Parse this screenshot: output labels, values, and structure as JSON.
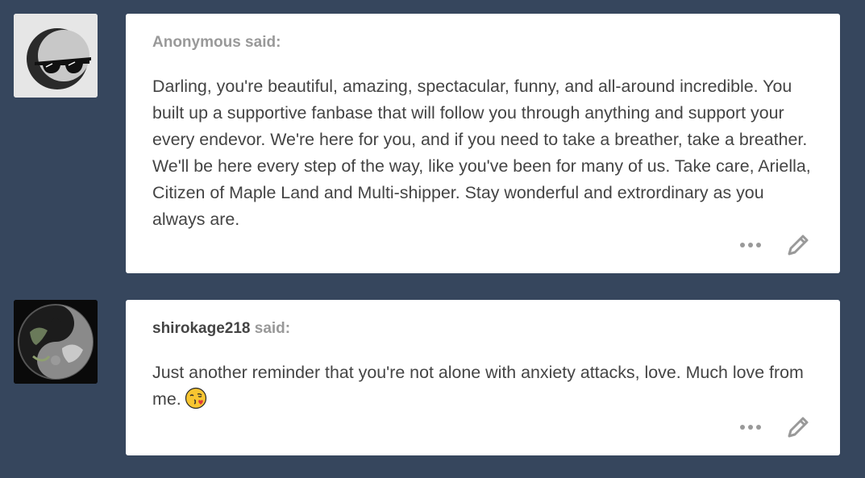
{
  "posts": [
    {
      "asker_name": "Anonymous",
      "asker_suffix": " said:",
      "body": "Darling, you're beautiful, amazing, spectacular, funny, and all-around incredible. You built up a supportive fanbase that will follow you through anything and support your every endevor. We're here for you, and if you need to take a breather, take a breather. We'll be here every step of the way, like you've been for many of us. Take care, Ariella, Citizen of Maple Land and Multi-shipper. Stay wonderful and extrordinary as you always are.",
      "avatar_icon": "anonymous-sunglasses-icon"
    },
    {
      "asker_name": "shirokage218",
      "asker_suffix": " said:",
      "body": "Just another reminder that you're not alone with anxiety attacks, love. Much love from me.",
      "emoji_icon": "face-blowing-kiss-icon",
      "avatar_icon": "dragon-tiger-avatar-icon"
    }
  ],
  "actions": {
    "more_icon": "more-dots-icon",
    "edit_icon": "pencil-icon"
  },
  "colors": {
    "background": "#36465d",
    "card": "#ffffff",
    "text": "#444444",
    "muted": "#999999"
  }
}
